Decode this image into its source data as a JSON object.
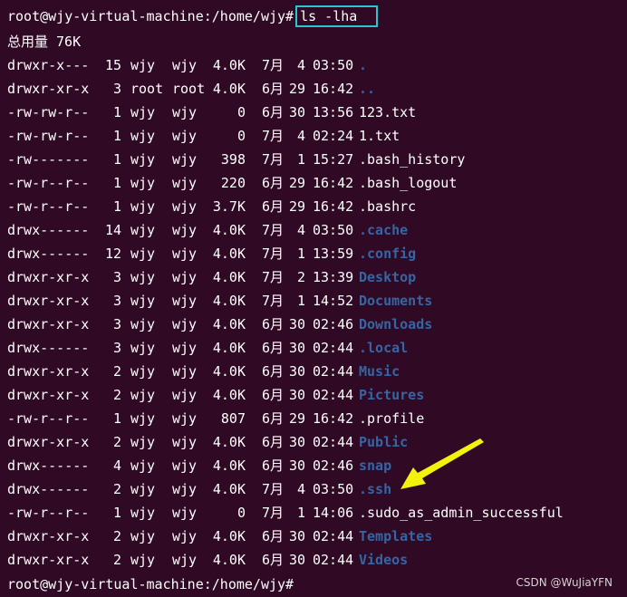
{
  "prompt": "root@wjy-virtual-machine:/home/wjy#",
  "command": "ls -lha",
  "total_line": "总用量 76K",
  "rows": [
    {
      "perm": "drwxr-x---",
      "links": "15",
      "owner": "wjy",
      "group": "wjy",
      "size": "4.0K",
      "month": "7月",
      "day": "4",
      "time": "03:50",
      "name": ".",
      "dir": true
    },
    {
      "perm": "drwxr-xr-x",
      "links": "3",
      "owner": "root",
      "group": "root",
      "size": "4.0K",
      "month": "6月",
      "day": "29",
      "time": "16:42",
      "name": "..",
      "dir": true
    },
    {
      "perm": "-rw-rw-r--",
      "links": "1",
      "owner": "wjy",
      "group": "wjy",
      "size": "0",
      "month": "6月",
      "day": "30",
      "time": "13:56",
      "name": "123.txt",
      "dir": false
    },
    {
      "perm": "-rw-rw-r--",
      "links": "1",
      "owner": "wjy",
      "group": "wjy",
      "size": "0",
      "month": "7月",
      "day": "4",
      "time": "02:24",
      "name": "1.txt",
      "dir": false
    },
    {
      "perm": "-rw-------",
      "links": "1",
      "owner": "wjy",
      "group": "wjy",
      "size": "398",
      "month": "7月",
      "day": "1",
      "time": "15:27",
      "name": ".bash_history",
      "dir": false
    },
    {
      "perm": "-rw-r--r--",
      "links": "1",
      "owner": "wjy",
      "group": "wjy",
      "size": "220",
      "month": "6月",
      "day": "29",
      "time": "16:42",
      "name": ".bash_logout",
      "dir": false
    },
    {
      "perm": "-rw-r--r--",
      "links": "1",
      "owner": "wjy",
      "group": "wjy",
      "size": "3.7K",
      "month": "6月",
      "day": "29",
      "time": "16:42",
      "name": ".bashrc",
      "dir": false
    },
    {
      "perm": "drwx------",
      "links": "14",
      "owner": "wjy",
      "group": "wjy",
      "size": "4.0K",
      "month": "7月",
      "day": "4",
      "time": "03:50",
      "name": ".cache",
      "dir": true
    },
    {
      "perm": "drwx------",
      "links": "12",
      "owner": "wjy",
      "group": "wjy",
      "size": "4.0K",
      "month": "7月",
      "day": "1",
      "time": "13:59",
      "name": ".config",
      "dir": true
    },
    {
      "perm": "drwxr-xr-x",
      "links": "3",
      "owner": "wjy",
      "group": "wjy",
      "size": "4.0K",
      "month": "7月",
      "day": "2",
      "time": "13:39",
      "name": "Desktop",
      "dir": true
    },
    {
      "perm": "drwxr-xr-x",
      "links": "3",
      "owner": "wjy",
      "group": "wjy",
      "size": "4.0K",
      "month": "7月",
      "day": "1",
      "time": "14:52",
      "name": "Documents",
      "dir": true
    },
    {
      "perm": "drwxr-xr-x",
      "links": "3",
      "owner": "wjy",
      "group": "wjy",
      "size": "4.0K",
      "month": "6月",
      "day": "30",
      "time": "02:46",
      "name": "Downloads",
      "dir": true
    },
    {
      "perm": "drwx------",
      "links": "3",
      "owner": "wjy",
      "group": "wjy",
      "size": "4.0K",
      "month": "6月",
      "day": "30",
      "time": "02:44",
      "name": ".local",
      "dir": true
    },
    {
      "perm": "drwxr-xr-x",
      "links": "2",
      "owner": "wjy",
      "group": "wjy",
      "size": "4.0K",
      "month": "6月",
      "day": "30",
      "time": "02:44",
      "name": "Music",
      "dir": true
    },
    {
      "perm": "drwxr-xr-x",
      "links": "2",
      "owner": "wjy",
      "group": "wjy",
      "size": "4.0K",
      "month": "6月",
      "day": "30",
      "time": "02:44",
      "name": "Pictures",
      "dir": true
    },
    {
      "perm": "-rw-r--r--",
      "links": "1",
      "owner": "wjy",
      "group": "wjy",
      "size": "807",
      "month": "6月",
      "day": "29",
      "time": "16:42",
      "name": ".profile",
      "dir": false
    },
    {
      "perm": "drwxr-xr-x",
      "links": "2",
      "owner": "wjy",
      "group": "wjy",
      "size": "4.0K",
      "month": "6月",
      "day": "30",
      "time": "02:44",
      "name": "Public",
      "dir": true
    },
    {
      "perm": "drwx------",
      "links": "4",
      "owner": "wjy",
      "group": "wjy",
      "size": "4.0K",
      "month": "6月",
      "day": "30",
      "time": "02:46",
      "name": "snap",
      "dir": true
    },
    {
      "perm": "drwx------",
      "links": "2",
      "owner": "wjy",
      "group": "wjy",
      "size": "4.0K",
      "month": "7月",
      "day": "4",
      "time": "03:50",
      "name": ".ssh",
      "dir": true
    },
    {
      "perm": "-rw-r--r--",
      "links": "1",
      "owner": "wjy",
      "group": "wjy",
      "size": "0",
      "month": "7月",
      "day": "1",
      "time": "14:06",
      "name": ".sudo_as_admin_successful",
      "dir": false
    },
    {
      "perm": "drwxr-xr-x",
      "links": "2",
      "owner": "wjy",
      "group": "wjy",
      "size": "4.0K",
      "month": "6月",
      "day": "30",
      "time": "02:44",
      "name": "Templates",
      "dir": true
    },
    {
      "perm": "drwxr-xr-x",
      "links": "2",
      "owner": "wjy",
      "group": "wjy",
      "size": "4.0K",
      "month": "6月",
      "day": "30",
      "time": "02:44",
      "name": "Videos",
      "dir": true
    }
  ],
  "final_prompt": "root@wjy-virtual-machine:/home/wjy#",
  "watermark": "CSDN @WuJiaYFN",
  "colors": {
    "background": "#300a24",
    "directory": "#3465a4",
    "highlight_box": "#2ec4cf",
    "annotation_arrow": "#f2f20a"
  }
}
